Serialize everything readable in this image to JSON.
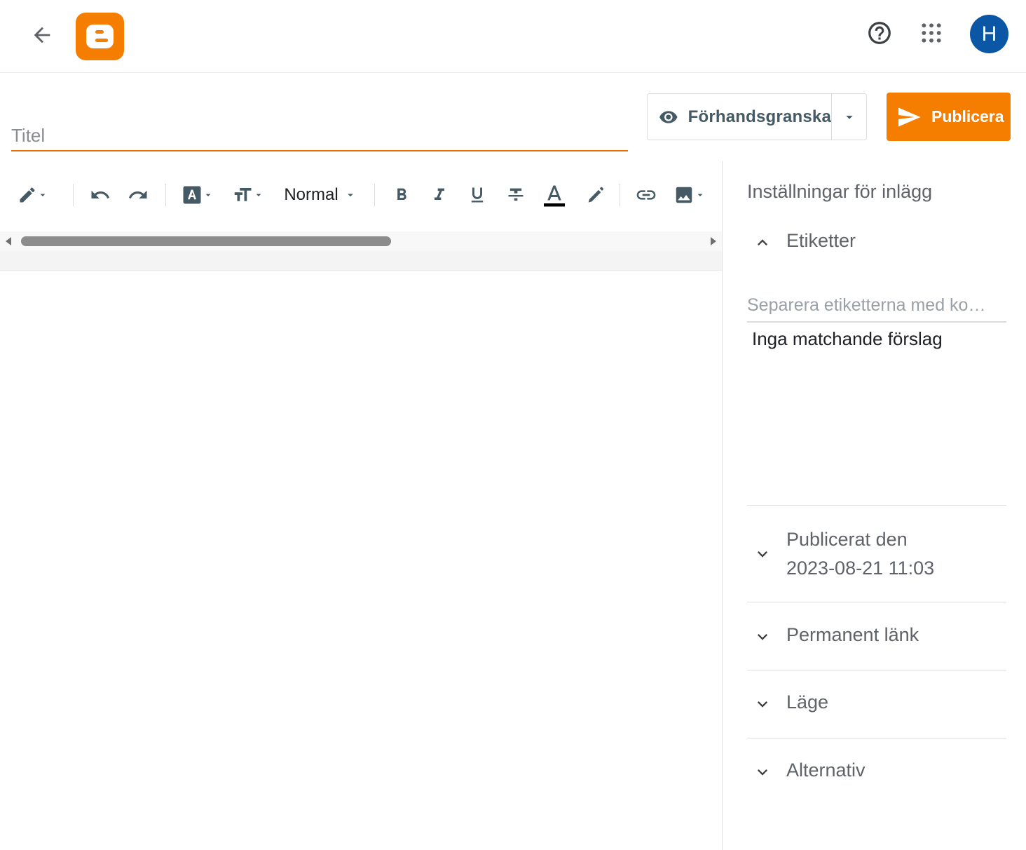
{
  "header": {
    "back_icon": "arrow-left-icon",
    "logo_icon": "blogger-logo",
    "help_icon": "help-circle-icon",
    "apps_icon": "apps-grid-icon",
    "avatar_initial": "H",
    "avatar_color": "#0b57a6"
  },
  "editor": {
    "title_placeholder": "Titel",
    "preview_label": "Förhandsgranska",
    "publish_label": "Publicera",
    "accent_color": "#f57d00"
  },
  "toolbar": {
    "paragraph_style": "Normal",
    "buttons": [
      "pencil-mode",
      "undo",
      "redo",
      "font-family",
      "font-size",
      "paragraph-style",
      "bold",
      "italic",
      "underline",
      "strikethrough",
      "text-color",
      "highlight",
      "link",
      "image"
    ]
  },
  "sidebar": {
    "heading": "Inställningar för inlägg",
    "labels_section": "Etiketter",
    "labels_placeholder": "Separera etiketterna med ko…",
    "no_match": "Inga matchande förslag",
    "published_label": "Publicerat den",
    "published_date": "2023-08-21 11:03",
    "permalink_label": "Permanent länk",
    "location_label": "Läge",
    "options_label": "Alternativ"
  }
}
